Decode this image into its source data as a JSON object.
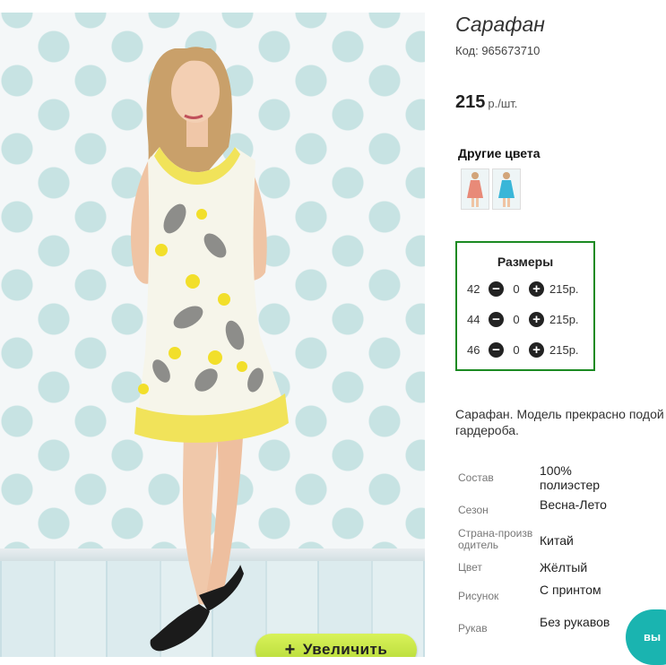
{
  "product": {
    "title": "Сарафан",
    "code": "Код: 965673710",
    "price_value": "215",
    "price_unit": "р./шт."
  },
  "image": {
    "zoom_button": "Увеличить",
    "zoom_icon": "plus-icon"
  },
  "other_colors": {
    "title": "Другие цвета",
    "swatch_accents": [
      "#e88a78",
      "#39b6d8"
    ]
  },
  "sizes": {
    "title": "Размеры",
    "rows": [
      {
        "size": "42",
        "qty": "0",
        "price": "215р."
      },
      {
        "size": "44",
        "qty": "0",
        "price": "215р."
      },
      {
        "size": "46",
        "qty": "0",
        "price": "215р."
      }
    ],
    "border_color": "#1b8a22"
  },
  "description": {
    "line1": "Сарафан. Модель прекрасно подой",
    "line2": "гардероба."
  },
  "properties": [
    {
      "key": "Состав",
      "value": "100% полиэстер"
    },
    {
      "key": "Сезон",
      "value": "Весна-Лето"
    },
    {
      "key": "Страна-производитель",
      "value": "Китай"
    },
    {
      "key": "Цвет",
      "value": "Жёлтый"
    },
    {
      "key": "Рисунок",
      "value": "С принтом"
    },
    {
      "key": "Рукав",
      "value": "Без рукавов"
    }
  ],
  "floating_button": {
    "label": "вы",
    "color": "#1ab4b0"
  }
}
